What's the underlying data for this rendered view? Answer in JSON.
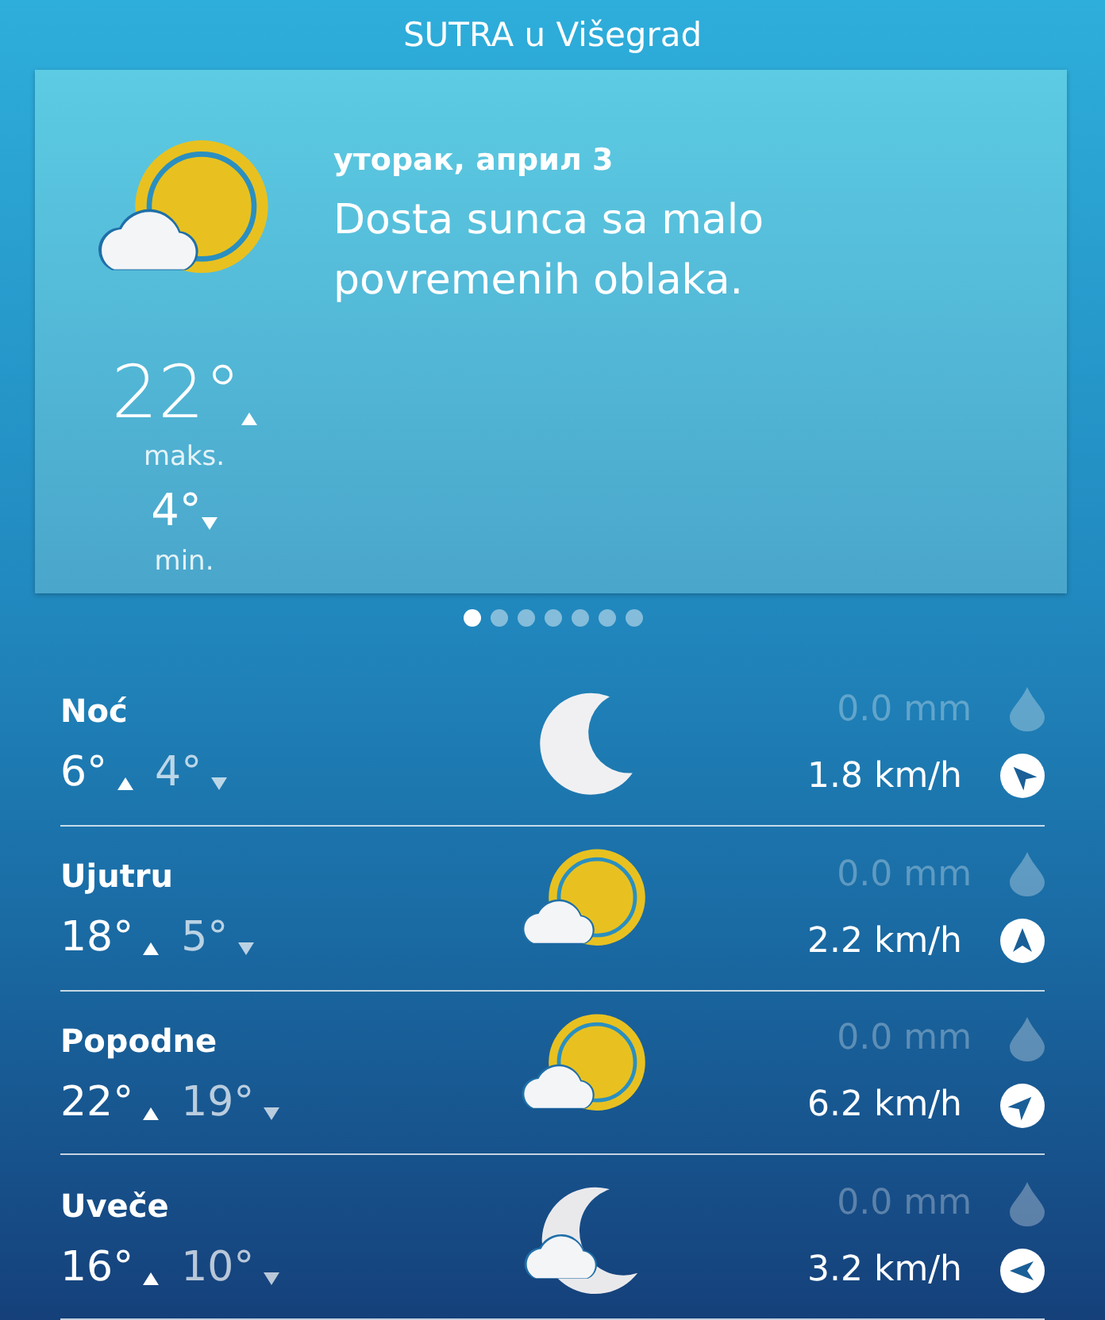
{
  "header": {
    "title": "SUTRA u Višegrad"
  },
  "forecast": {
    "kind": "sun_cloud",
    "date": "уторак, април 3",
    "description": "Dosta sunca sa malo povremenih oblaka.",
    "max": "22°",
    "max_label": "maks.",
    "min": "4°",
    "min_label": "min."
  },
  "pager": [
    {
      "selected": true
    },
    {
      "selected": false
    },
    {
      "selected": false
    },
    {
      "selected": false
    },
    {
      "selected": false
    },
    {
      "selected": false
    },
    {
      "selected": false
    }
  ],
  "periods": [
    {
      "name": "Noć",
      "high": "6°",
      "low": "4°",
      "kind": "moon",
      "precipitation": "0.0 mm",
      "wind": "1.8 km/h"
    },
    {
      "name": "Ujutru",
      "high": "18°",
      "low": "5°",
      "kind": "sun_cloud",
      "precipitation": "0.0 mm",
      "wind": "2.2 km/h"
    },
    {
      "name": "Popodne",
      "high": "22°",
      "low": "19°",
      "kind": "sun_cloud",
      "precipitation": "0.0 mm",
      "wind": "6.2 km/h"
    },
    {
      "name": "Uveče",
      "high": "16°",
      "low": "10°",
      "kind": "moon_cloud",
      "precipitation": "0.0 mm",
      "wind": "3.2 km/h"
    }
  ]
}
